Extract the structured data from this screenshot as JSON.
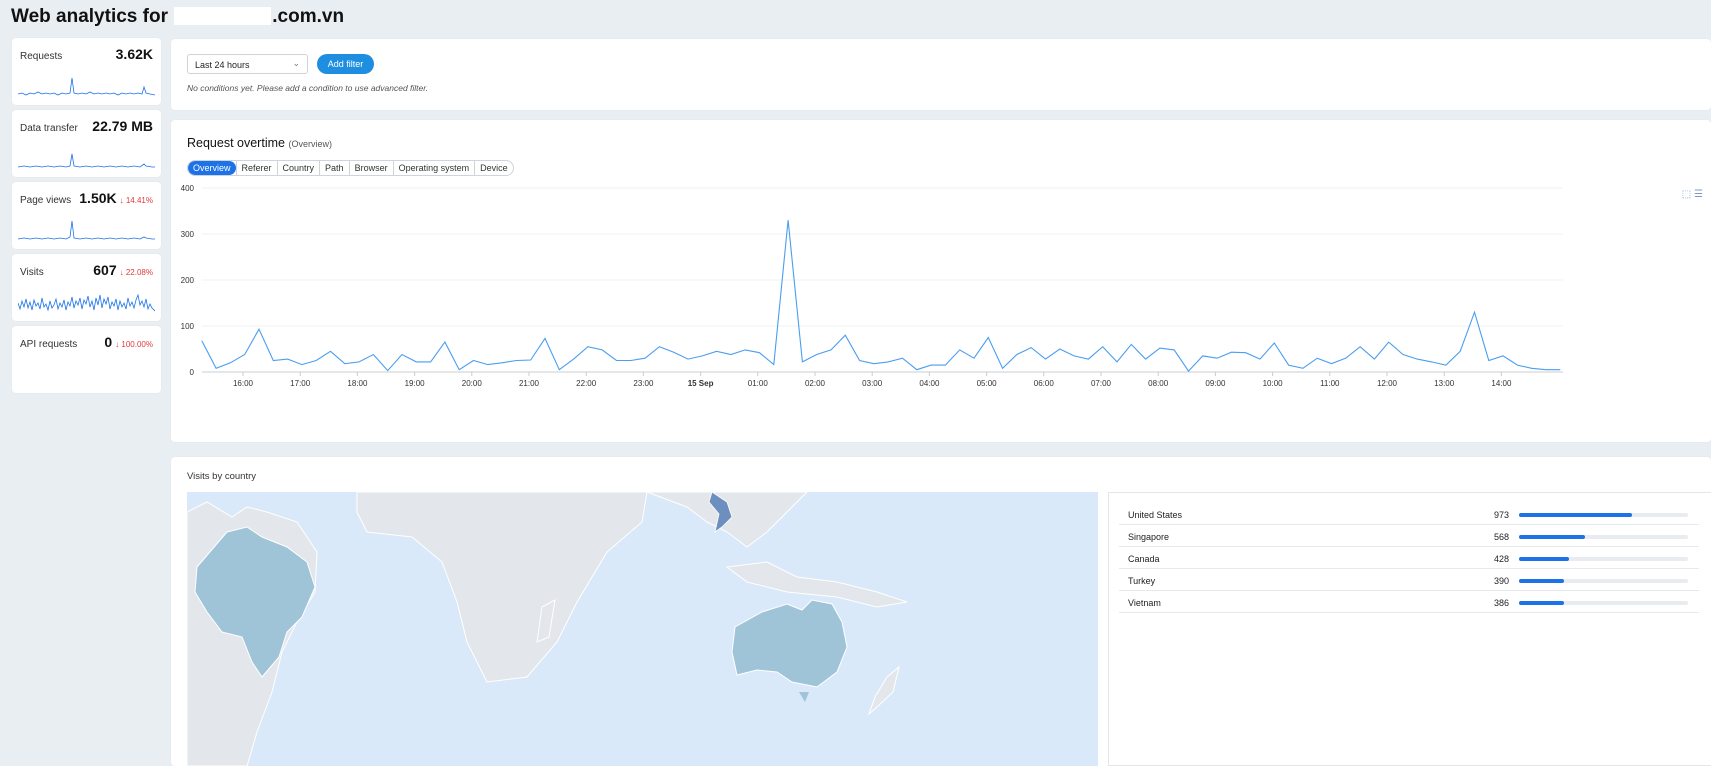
{
  "page": {
    "title_prefix": "Web analytics for",
    "title_suffix": ".com.vn"
  },
  "metrics": [
    {
      "label": "Requests",
      "value": "3.62K",
      "delta": ""
    },
    {
      "label": "Data transfer",
      "value": "22.79 MB",
      "delta": ""
    },
    {
      "label": "Page views",
      "value": "1.50K",
      "delta": "14.41%"
    },
    {
      "label": "Visits",
      "value": "607",
      "delta": "22.08%"
    },
    {
      "label": "API requests",
      "value": "0",
      "delta": "100.00%"
    }
  ],
  "colors": {
    "accent": "#1d72e8",
    "line": "#4a9ef0",
    "button": "#1e8fe0",
    "negative": "#e03a3a",
    "map_water": "#d9e9fa",
    "map_land": "#e3e6ea",
    "map_highlight": "#9fc4d8",
    "map_top": "#6d8fbf"
  },
  "filter": {
    "range_value": "Last 24 hours",
    "add_filter_label": "Add filter",
    "no_conditions_text": "No conditions yet. Please add a condition to use advanced filter."
  },
  "request_chart": {
    "title": "Request overtime",
    "subtitle": "(Overview)",
    "tabs": [
      "Overview",
      "Referer",
      "Country",
      "Path",
      "Browser",
      "Operating system",
      "Device"
    ],
    "active_tab": "Overview",
    "icons": [
      "selection-icon",
      "list-icon"
    ]
  },
  "chart_data": {
    "type": "line",
    "title": "",
    "xlabel": "",
    "ylabel": "",
    "ylim": [
      0,
      400
    ],
    "yticks": [
      "0",
      "100",
      "200",
      "300",
      "400"
    ],
    "xticks": [
      "16:00",
      "17:00",
      "18:00",
      "19:00",
      "20:00",
      "21:00",
      "22:00",
      "23:00",
      "15 Sep",
      "01:00",
      "02:00",
      "03:00",
      "04:00",
      "05:00",
      "06:00",
      "07:00",
      "08:00",
      "09:00",
      "10:00",
      "11:00",
      "12:00",
      "13:00",
      "14:00"
    ],
    "x_start_hour_offset": -0.72,
    "x_step_hours": 0.25,
    "grid": true,
    "series": [
      {
        "values": [
          68,
          8,
          20,
          38,
          93,
          25,
          28,
          16,
          25,
          45,
          18,
          22,
          38,
          3,
          38,
          22,
          22,
          65,
          5,
          25,
          16,
          20,
          25,
          26,
          73,
          5,
          28,
          55,
          48,
          25,
          25,
          30,
          55,
          43,
          28,
          35,
          45,
          38,
          48,
          42,
          16,
          330,
          22,
          38,
          48,
          80,
          25,
          18,
          22,
          30,
          5,
          15,
          15,
          48,
          30,
          75,
          8,
          38,
          53,
          28,
          50,
          35,
          28,
          55,
          22,
          60,
          28,
          52,
          48,
          2,
          35,
          30,
          43,
          42,
          28,
          63,
          15,
          8,
          30,
          18,
          30,
          55,
          28,
          65,
          38,
          28,
          22,
          15,
          45,
          130,
          25,
          35,
          15,
          8,
          5,
          5
        ]
      }
    ]
  },
  "countries": {
    "title": "Visits by country",
    "max": 1450,
    "rows": [
      {
        "name": "United States",
        "value": "973",
        "n": 973
      },
      {
        "name": "Singapore",
        "value": "568",
        "n": 568
      },
      {
        "name": "Canada",
        "value": "428",
        "n": 428
      },
      {
        "name": "Turkey",
        "value": "390",
        "n": 390
      },
      {
        "name": "Vietnam",
        "value": "386",
        "n": 386
      }
    ]
  }
}
